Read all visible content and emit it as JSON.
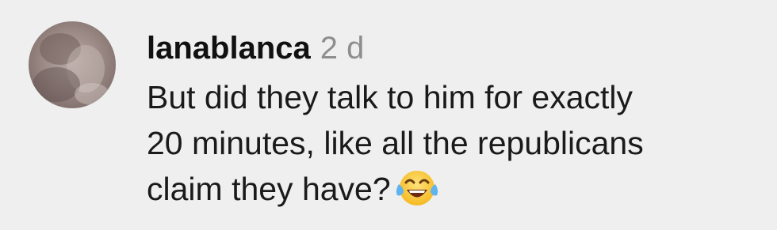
{
  "comment": {
    "username": "lanablanca",
    "timestamp": "2 d",
    "text_lines": [
      "But did they talk to him for exactly",
      "20 minutes, like all the republicans",
      "claim they have?"
    ],
    "emoji_icon": "face-with-tears-of-joy-icon",
    "avatar_icon": "user-avatar"
  },
  "colors": {
    "background": "#efefef",
    "username": "#111111",
    "timestamp": "#8e8e8e",
    "text": "#1a1a1a"
  }
}
